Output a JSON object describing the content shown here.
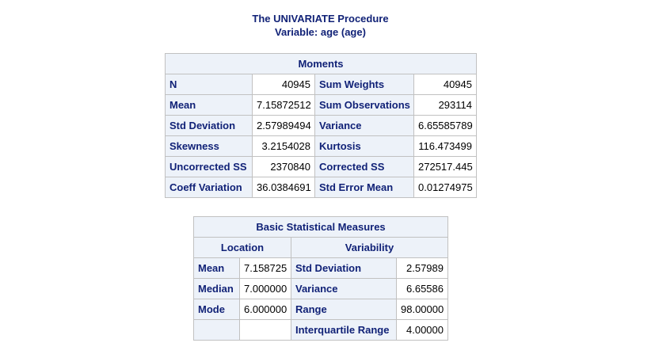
{
  "titles": {
    "line1": "The UNIVARIATE Procedure",
    "line2": "Variable: age (age)"
  },
  "moments": {
    "caption": "Moments",
    "rows": [
      {
        "label1": "N",
        "value1": "40945",
        "label2": "Sum Weights",
        "value2": "40945"
      },
      {
        "label1": "Mean",
        "value1": "7.15872512",
        "label2": "Sum Observations",
        "value2": "293114"
      },
      {
        "label1": "Std Deviation",
        "value1": "2.57989494",
        "label2": "Variance",
        "value2": "6.65585789"
      },
      {
        "label1": "Skewness",
        "value1": "3.2154028",
        "label2": "Kurtosis",
        "value2": "116.473499"
      },
      {
        "label1": "Uncorrected SS",
        "value1": "2370840",
        "label2": "Corrected SS",
        "value2": "272517.445"
      },
      {
        "label1": "Coeff Variation",
        "value1": "36.0384691",
        "label2": "Std Error Mean",
        "value2": "0.01274975"
      }
    ]
  },
  "basic": {
    "caption": "Basic Statistical Measures",
    "location_header": "Location",
    "variability_header": "Variability",
    "rows": [
      {
        "loc_label": "Mean",
        "loc_value": "7.158725",
        "var_label": "Std Deviation",
        "var_value": "2.57989"
      },
      {
        "loc_label": "Median",
        "loc_value": "7.000000",
        "var_label": "Variance",
        "var_value": "6.65586"
      },
      {
        "loc_label": "Mode",
        "loc_value": "6.000000",
        "var_label": "Range",
        "var_value": "98.00000"
      },
      {
        "loc_label": "",
        "loc_value": "",
        "var_label": "Interquartile Range",
        "var_value": "4.00000"
      }
    ]
  }
}
